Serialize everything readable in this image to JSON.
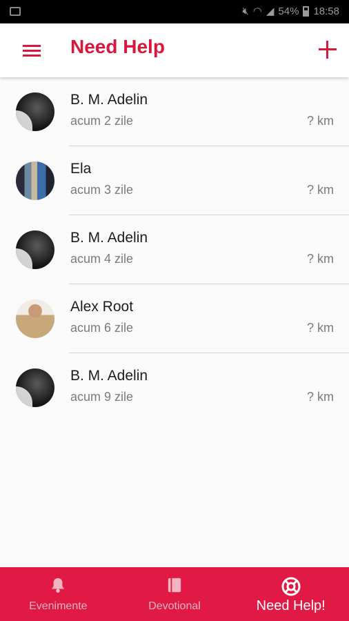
{
  "status_bar": {
    "battery": "54%",
    "time": "18:58"
  },
  "app_bar": {
    "title": "Need Help"
  },
  "requests": [
    {
      "name": "B. M. Adelin",
      "time": "acum 2 zile",
      "distance": "? km",
      "avatar": "wolf"
    },
    {
      "name": "Ela",
      "time": "acum 3 zile",
      "distance": "? km",
      "avatar": "ela"
    },
    {
      "name": "B. M. Adelin",
      "time": "acum 4 zile",
      "distance": "? km",
      "avatar": "wolf"
    },
    {
      "name": "Alex Root",
      "time": "acum 6 zile",
      "distance": "? km",
      "avatar": "alex"
    },
    {
      "name": "B. M. Adelin",
      "time": "acum 9 zile",
      "distance": "? km",
      "avatar": "wolf"
    }
  ],
  "bottom_nav": {
    "tabs": [
      {
        "label": "Evenimente",
        "icon": "bell-icon"
      },
      {
        "label": "Devotional",
        "icon": "book-icon"
      },
      {
        "label": "Need Help!",
        "icon": "lifebuoy-icon"
      }
    ]
  },
  "colors": {
    "accent": "#d9163c",
    "nav_background": "#e01a45"
  }
}
